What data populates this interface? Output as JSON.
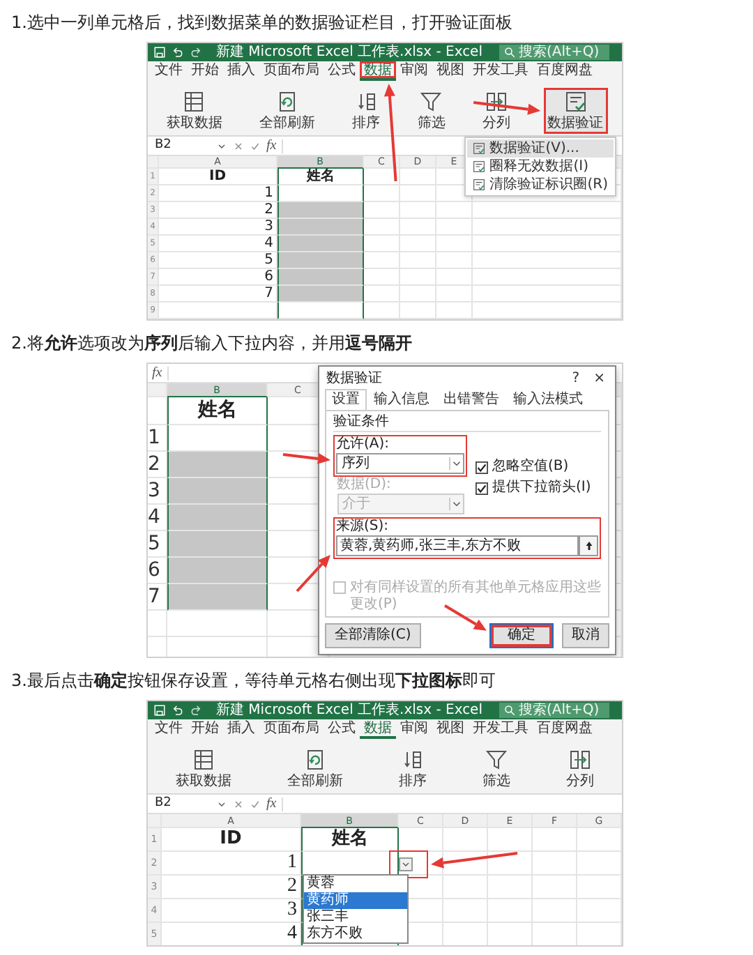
{
  "steps": [
    {
      "caption": "1.选中一列单元格后，找到数据菜单的数据验证栏目，打开验证面板",
      "screenshot": {
        "kind": "ribbon",
        "title_bar": {
          "title": "新建 Microsoft Excel 工作表.xlsx - Excel",
          "search": {
            "placeholder": "搜索(Alt+Q)"
          }
        },
        "tabs": [
          {
            "label": "文件",
            "selected": false,
            "highlighted": false
          },
          {
            "label": "开始",
            "selected": false,
            "highlighted": false
          },
          {
            "label": "插入",
            "selected": false,
            "highlighted": false
          },
          {
            "label": "页面布局",
            "selected": false,
            "highlighted": false
          },
          {
            "label": "公式",
            "selected": false,
            "highlighted": false
          },
          {
            "label": "数据",
            "selected": true,
            "highlighted": true
          },
          {
            "label": "审阅",
            "selected": false,
            "highlighted": false
          },
          {
            "label": "视图",
            "selected": false,
            "highlighted": false
          },
          {
            "label": "开发工具",
            "selected": false,
            "highlighted": false
          },
          {
            "label": "百度网盘",
            "selected": false,
            "highlighted": false
          }
        ],
        "ribbon": [
          {
            "label": "获取数据",
            "kind": "table",
            "highlighted": false
          },
          {
            "label": "全部刷新",
            "kind": "refresh",
            "highlighted": false
          },
          {
            "label": "排序",
            "kind": "sort",
            "highlighted": false
          },
          {
            "label": "筛选",
            "kind": "filter",
            "highlighted": false
          },
          {
            "label": "分列",
            "kind": "split",
            "highlighted": false
          },
          {
            "label": "数据验证",
            "kind": "validate",
            "highlighted": true
          }
        ],
        "menu": [
          {
            "label": "数据验证(V)...",
            "selected": true
          },
          {
            "label": "圈释无效数据(I)",
            "selected": false
          },
          {
            "label": "清除验证标识圈(R)",
            "selected": false
          }
        ],
        "formula_bar": {
          "name_box": "B2",
          "function_label": "fx"
        },
        "columns": [
          {
            "label": "A",
            "selected": false
          },
          {
            "label": "B",
            "selected": true
          },
          {
            "label": "C",
            "selected": false
          },
          {
            "label": "D",
            "selected": false
          },
          {
            "label": "E",
            "selected": false
          }
        ],
        "rows": [
          {
            "number": "1",
            "kind": "header",
            "cells": [
              "ID",
              "姓名"
            ]
          },
          {
            "number": "2",
            "kind": "data",
            "cells": [
              "1"
            ],
            "selected": false
          },
          {
            "number": "3",
            "kind": "data",
            "cells": [
              "2"
            ],
            "selected": true
          },
          {
            "number": "4",
            "kind": "data",
            "cells": [
              "3"
            ],
            "selected": true
          },
          {
            "number": "5",
            "kind": "data",
            "cells": [
              "4"
            ],
            "selected": true
          },
          {
            "number": "6",
            "kind": "data",
            "cells": [
              "5"
            ],
            "selected": true
          },
          {
            "number": "7",
            "kind": "data",
            "cells": [
              "6"
            ],
            "selected": true
          },
          {
            "number": "8",
            "kind": "data",
            "cells": [
              "7"
            ],
            "selected": true
          },
          {
            "number": "9",
            "kind": "data"
          }
        ]
      }
    },
    {
      "caption": "2.将**允许**选项改为**序列**后输入下拉内容，并用**逗号隔开**",
      "screenshot": {
        "kind": "dialog",
        "formula_bar": {
          "function_label": "fx"
        },
        "columns": [
          {
            "label": "B",
            "selected": true
          },
          {
            "label": "C",
            "selected": false
          }
        ],
        "rows": [
          {
            "kind": "header",
            "cells": [
              "姓名"
            ]
          },
          {
            "number": "1",
            "kind": "data",
            "selected": false
          },
          {
            "number": "2",
            "kind": "data",
            "selected": true
          },
          {
            "number": "3",
            "kind": "data",
            "selected": true
          },
          {
            "number": "4",
            "kind": "data",
            "selected": true
          },
          {
            "number": "5",
            "kind": "data",
            "selected": true
          },
          {
            "number": "6",
            "kind": "data",
            "selected": true
          },
          {
            "number": "7",
            "kind": "data",
            "selected": true
          }
        ],
        "dialog": {
          "title": "数据验证",
          "help": "?",
          "close": "×",
          "tabs": [
            {
              "label": "设置",
              "selected": true
            },
            {
              "label": "输入信息",
              "selected": false
            },
            {
              "label": "出错警告",
              "selected": false
            },
            {
              "label": "输入法模式",
              "selected": false
            }
          ],
          "section": "验证条件",
          "allow": {
            "label": "允许(A):",
            "value": "序列",
            "highlighted": true
          },
          "options": [
            {
              "label": "忽略空值(B)",
              "checked": true
            },
            {
              "label": "提供下拉箭头(I)",
              "checked": true
            }
          ],
          "data": {
            "label": "数据(D):",
            "value": "介于",
            "disabled": true
          },
          "source": {
            "label": "来源(S):",
            "value": "黄蓉,黄药师,张三丰,东方不败",
            "highlighted": true
          },
          "apply_all": {
            "label": "对有同样设置的所有其他单元格应用这些更改(P)",
            "checked": false,
            "disabled": true
          },
          "buttons": [
            {
              "label": "全部清除(C)",
              "highlighted": false,
              "default": false
            },
            {
              "label": "确定",
              "highlighted": true,
              "default": true
            },
            {
              "label": "取消",
              "highlighted": false,
              "default": false
            }
          ]
        }
      }
    },
    {
      "caption": "3.最后点击**确定**按钮保存设置，等待单元格右侧出现**下拉图标**即可",
      "screenshot": {
        "kind": "ribbon",
        "title_bar": {
          "title": "新建 Microsoft Excel 工作表.xlsx - Excel",
          "search": {
            "placeholder": "搜索(Alt+Q)"
          }
        },
        "tabs": [
          {
            "label": "文件",
            "selected": false,
            "highlighted": false
          },
          {
            "label": "开始",
            "selected": false,
            "highlighted": false
          },
          {
            "label": "插入",
            "selected": false,
            "highlighted": false
          },
          {
            "label": "页面布局",
            "selected": false,
            "highlighted": false
          },
          {
            "label": "公式",
            "selected": false,
            "highlighted": false
          },
          {
            "label": "数据",
            "selected": true,
            "highlighted": false
          },
          {
            "label": "审阅",
            "selected": false,
            "highlighted": false
          },
          {
            "label": "视图",
            "selected": false,
            "highlighted": false
          },
          {
            "label": "开发工具",
            "selected": false,
            "highlighted": false
          },
          {
            "label": "百度网盘",
            "selected": false,
            "highlighted": false
          }
        ],
        "ribbon": [
          {
            "label": "获取数据",
            "kind": "table",
            "highlighted": false
          },
          {
            "label": "全部刷新",
            "kind": "refresh",
            "highlighted": false
          },
          {
            "label": "排序",
            "kind": "sort",
            "highlighted": false
          },
          {
            "label": "筛选",
            "kind": "filter",
            "highlighted": false
          },
          {
            "label": "分列",
            "kind": "split",
            "highlighted": false
          }
        ],
        "formula_bar": {
          "name_box": "B2",
          "function_label": "fx"
        },
        "columns": [
          {
            "label": "A",
            "selected": false
          },
          {
            "label": "B",
            "selected": true
          },
          {
            "label": "C",
            "selected": false
          },
          {
            "label": "D",
            "selected": false
          },
          {
            "label": "E",
            "selected": false
          },
          {
            "label": "F",
            "selected": false
          },
          {
            "label": "G",
            "selected": false
          }
        ],
        "rows": [
          {
            "number": "1",
            "kind": "header",
            "cells": [
              "ID",
              "姓名"
            ]
          },
          {
            "number": "2",
            "kind": "data",
            "cells": [
              "1"
            ],
            "dropdown": {
              "highlighted": true,
              "open": true,
              "items": [
                {
                  "label": "黄蓉",
                  "selected": false
                },
                {
                  "label": "黄药师",
                  "selected": true
                },
                {
                  "label": "张三丰",
                  "selected": false
                },
                {
                  "label": "东方不败",
                  "selected": false
                }
              ]
            }
          },
          {
            "number": "3",
            "kind": "data",
            "cells": [
              "2"
            ]
          },
          {
            "number": "4",
            "kind": "data",
            "cells": [
              "3"
            ]
          },
          {
            "number": "5",
            "kind": "data",
            "cells": [
              "4"
            ]
          }
        ]
      }
    }
  ]
}
